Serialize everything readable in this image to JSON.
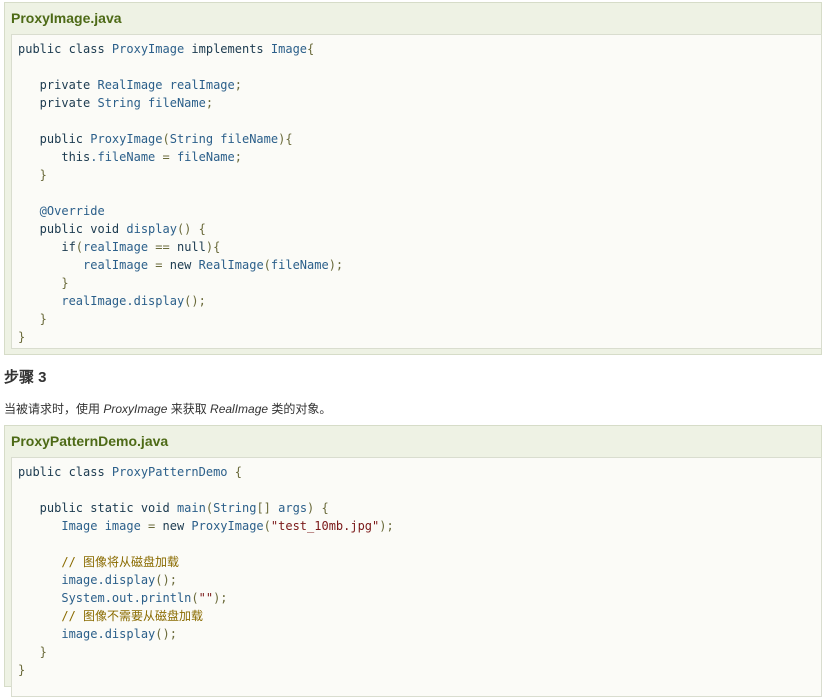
{
  "examples": [
    {
      "title": "ProxyImage.java",
      "lines": [
        [
          [
            "kw",
            "public class "
          ],
          [
            "id",
            "ProxyImage "
          ],
          [
            "kw",
            "implements "
          ],
          [
            "id",
            "Image"
          ],
          [
            "pn",
            "{"
          ]
        ],
        [],
        [
          [
            "kw",
            "   private "
          ],
          [
            "id",
            "RealImage realImage"
          ],
          [
            "pn",
            ";"
          ]
        ],
        [
          [
            "kw",
            "   private "
          ],
          [
            "id",
            "String fileName"
          ],
          [
            "pn",
            ";"
          ]
        ],
        [],
        [
          [
            "kw",
            "   public "
          ],
          [
            "id",
            "ProxyImage"
          ],
          [
            "pn",
            "("
          ],
          [
            "id",
            "String fileName"
          ],
          [
            "pn",
            "){"
          ]
        ],
        [
          [
            "kw",
            "      this"
          ],
          [
            "id",
            ".fileName "
          ],
          [
            "pn",
            "= "
          ],
          [
            "id",
            "fileName"
          ],
          [
            "pn",
            ";"
          ]
        ],
        [
          [
            "pn",
            "   }"
          ]
        ],
        [],
        [
          [
            "id",
            "   @Override"
          ]
        ],
        [
          [
            "kw",
            "   public void "
          ],
          [
            "id",
            "display"
          ],
          [
            "pn",
            "() {"
          ]
        ],
        [
          [
            "kw",
            "      if"
          ],
          [
            "pn",
            "("
          ],
          [
            "id",
            "realImage "
          ],
          [
            "pn",
            "== "
          ],
          [
            "kw",
            "null"
          ],
          [
            "pn",
            "){"
          ]
        ],
        [
          [
            "id",
            "         realImage "
          ],
          [
            "pn",
            "= "
          ],
          [
            "kw",
            "new "
          ],
          [
            "id",
            "RealImage"
          ],
          [
            "pn",
            "("
          ],
          [
            "id",
            "fileName"
          ],
          [
            "pn",
            ");"
          ]
        ],
        [
          [
            "pn",
            "      }"
          ]
        ],
        [
          [
            "id",
            "      realImage.display"
          ],
          [
            "pn",
            "();"
          ]
        ],
        [
          [
            "pn",
            "   }"
          ]
        ],
        [
          [
            "pn",
            "}"
          ]
        ]
      ]
    },
    {
      "title": "ProxyPatternDemo.java",
      "lines": [
        [
          [
            "kw",
            "public class "
          ],
          [
            "id",
            "ProxyPatternDemo "
          ],
          [
            "pn",
            "{"
          ]
        ],
        [],
        [
          [
            "kw",
            "   public static void "
          ],
          [
            "id",
            "main"
          ],
          [
            "pn",
            "("
          ],
          [
            "id",
            "String"
          ],
          [
            "pn",
            "[] "
          ],
          [
            "id",
            "args"
          ],
          [
            "pn",
            ") {"
          ]
        ],
        [
          [
            "id",
            "      Image image "
          ],
          [
            "pn",
            "= "
          ],
          [
            "kw",
            "new "
          ],
          [
            "id",
            "ProxyImage"
          ],
          [
            "pn",
            "("
          ],
          [
            "str",
            "\"test_10mb.jpg\""
          ],
          [
            "pn",
            ");"
          ]
        ],
        [],
        [
          [
            "cmt",
            "      // 图像将从磁盘加载"
          ]
        ],
        [
          [
            "id",
            "      image.display"
          ],
          [
            "pn",
            "();"
          ]
        ],
        [
          [
            "id",
            "      System.out.println"
          ],
          [
            "pn",
            "("
          ],
          [
            "str",
            "\"\""
          ],
          [
            "pn",
            ");"
          ]
        ],
        [
          [
            "cmt",
            "      // 图像不需要从磁盘加载"
          ]
        ],
        [
          [
            "id",
            "      image.display"
          ],
          [
            "pn",
            "();"
          ]
        ],
        [
          [
            "pn",
            "   }"
          ]
        ],
        [
          [
            "pn",
            "}"
          ]
        ]
      ]
    }
  ],
  "step": {
    "heading": "步骤 3",
    "text_before": "当被请求时，使用 ",
    "em1": "ProxyImage",
    "text_middle": " 来获取 ",
    "em2": "RealImage",
    "text_after": " 类的对象。"
  }
}
